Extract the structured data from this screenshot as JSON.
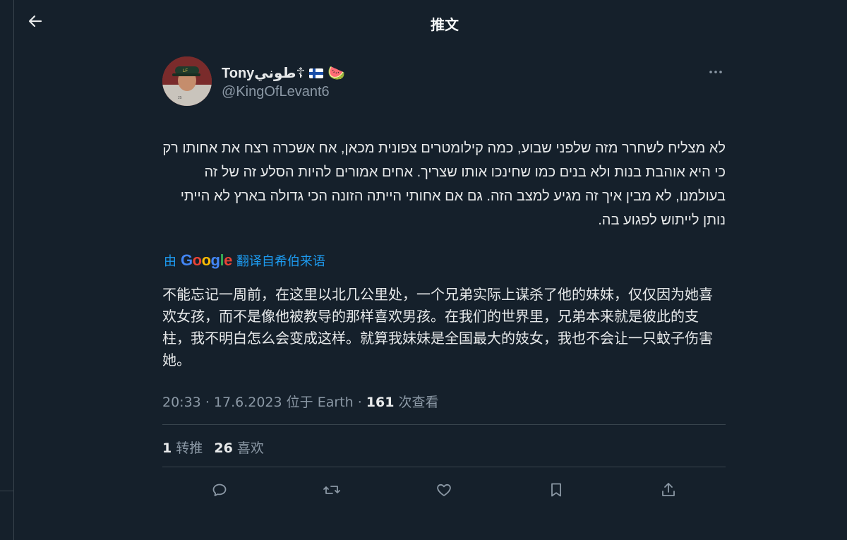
{
  "header": {
    "title": "推文"
  },
  "author": {
    "display_name": "Tonyطوني☦",
    "watermelon": "🍉",
    "handle": "@KingOfLevant6",
    "avatar_caption": "25"
  },
  "tweet": {
    "text": "לא מצליח לשחרר מזה שלפני שבוע, כמה קילומטרים צפונית מכאן, אח אשכרה רצח את אחותו רק כי היא אוהבת בנות ולא בנים כמו שחינכו אותו שצריך. אחים אמורים להיות הסלע זה של זה בעולמנו, לא מבין איך זה מגיע למצב הזה. גם אם אחותי הייתה הזונה הכי גדולה בארץ לא הייתי נותן לייתוש לפגוע בה.",
    "translate_prefix": "由",
    "translate_brand": "Google",
    "translate_suffix": "翻译自希伯来语",
    "translated_text": "不能忘记一周前，在这里以北几公里处，一个兄弟实际上谋杀了他的妹妹，仅仅因为她喜欢女孩，而不是像他被教导的那样喜欢男孩。在我们的世界里，兄弟本来就是彼此的支柱，我不明白怎么会变成这样。就算我妹妹是全国最大的妓女，我也不会让一只蚊子伤害她。"
  },
  "meta": {
    "time": "20:33",
    "date": "17.6.2023",
    "location": "位于 Earth",
    "views_count": "161",
    "views_label": "次查看"
  },
  "stats": {
    "retweets_count": "1",
    "retweets_label": "转推",
    "likes_count": "26",
    "likes_label": "喜欢"
  },
  "icons": {
    "back": "arrow-left-icon",
    "more": "more-dots-icon",
    "reply": "reply-icon",
    "retweet": "retweet-icon",
    "like": "heart-icon",
    "bookmark": "bookmark-icon",
    "share": "share-icon"
  },
  "colors": {
    "background": "#15202b",
    "text": "#e7e9ea",
    "secondary": "#8b98a5",
    "accent": "#1d9bf0",
    "divider": "#38444d"
  }
}
